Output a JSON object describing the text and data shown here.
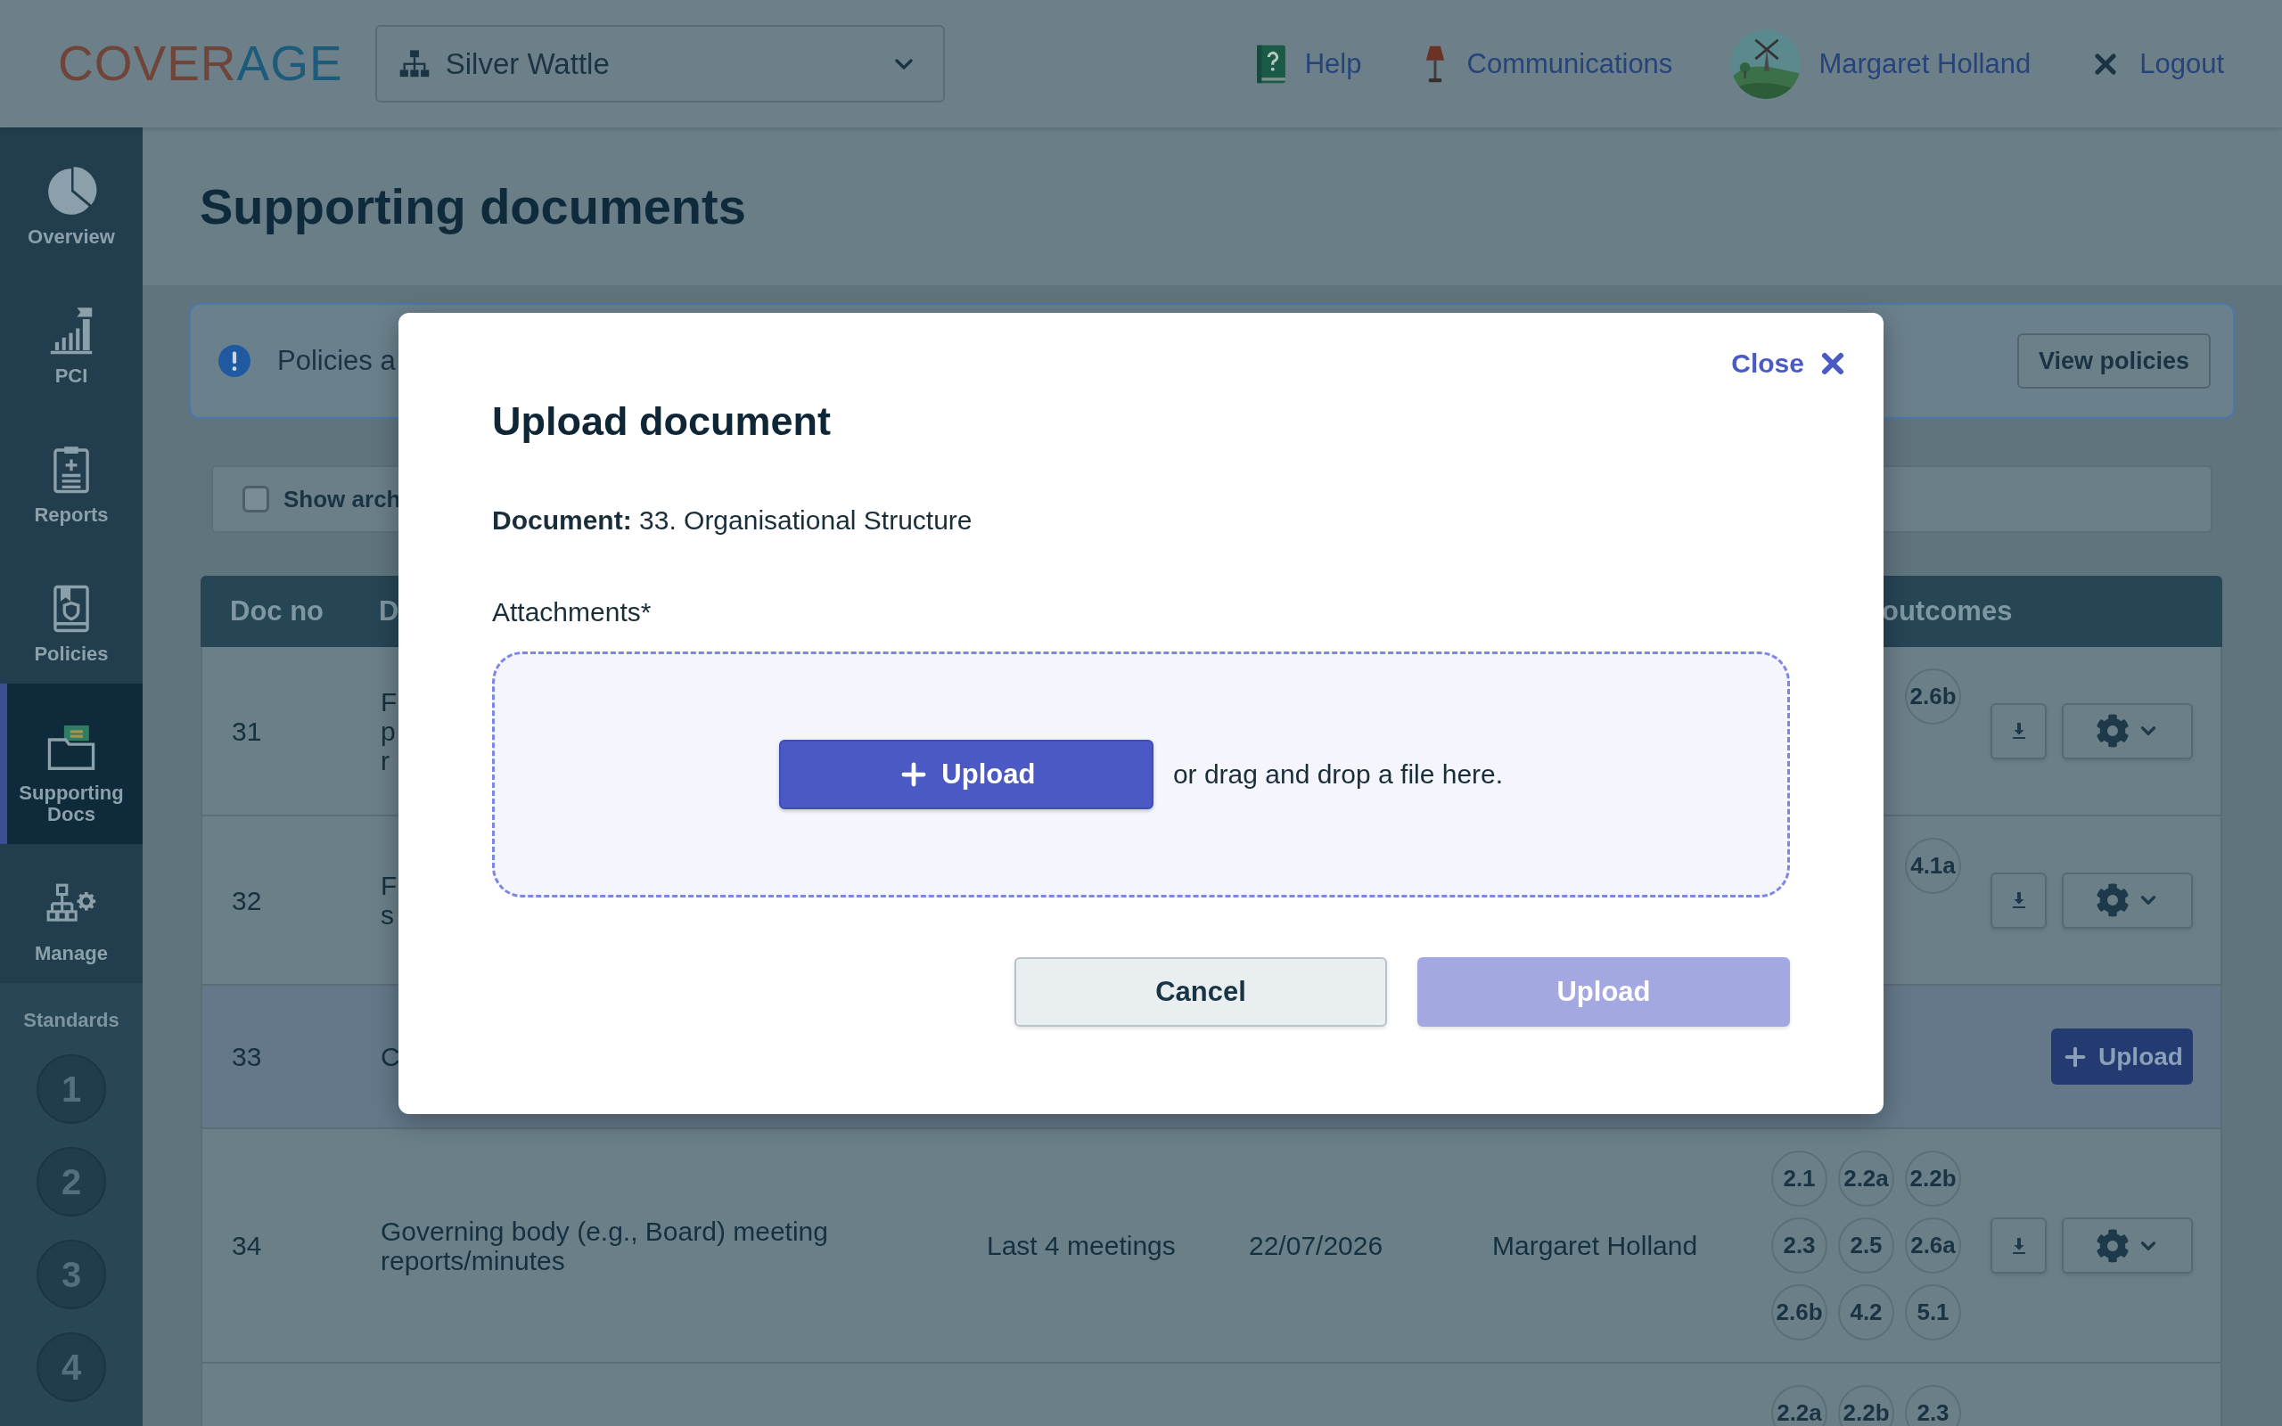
{
  "header": {
    "logo": [
      {
        "text": "COVER",
        "color": "#6e4538"
      },
      {
        "text": "AGE",
        "color": "#1d5b7b"
      }
    ],
    "site_selector": {
      "value": "Silver Wattle"
    },
    "links": [
      {
        "kind": "help",
        "label": "Help"
      },
      {
        "kind": "communications",
        "label": "Communications"
      },
      {
        "kind": "profile",
        "label": "Margaret Holland"
      },
      {
        "kind": "logout",
        "label": "Logout"
      }
    ]
  },
  "sidebar": {
    "items": [
      {
        "kind": "overview",
        "label": "Overview",
        "selected": false
      },
      {
        "kind": "pci",
        "label": "PCI",
        "selected": false
      },
      {
        "kind": "reports",
        "label": "Reports",
        "selected": false
      },
      {
        "kind": "policies",
        "label": "Policies",
        "selected": false
      },
      {
        "kind": "supporting_docs",
        "label": "Supporting Docs",
        "selected": true
      },
      {
        "kind": "manage",
        "label": "Manage",
        "selected": false
      }
    ],
    "standards": {
      "heading": "Standards",
      "items": [
        "1",
        "2",
        "3",
        "4"
      ]
    }
  },
  "page": {
    "title": "Supporting documents"
  },
  "banner": {
    "text": "Policies a",
    "button": "View policies"
  },
  "filter": {
    "label": "Show arch",
    "checked": false
  },
  "table": {
    "columns": [
      "Doc no",
      "D",
      "outcomes"
    ],
    "rows": [
      {
        "kind": "uploaded",
        "doc_no": "31",
        "description": "F\np\nr",
        "outcomes": [
          "2.6b"
        ]
      },
      {
        "kind": "uploaded",
        "doc_no": "32",
        "description": "F\ns",
        "outcomes": [
          "4.1a"
        ]
      },
      {
        "kind": "pending",
        "doc_no": "33",
        "description": "C",
        "upload_label": "Upload"
      },
      {
        "kind": "uploaded",
        "doc_no": "34",
        "description": "Governing body (e.g., Board) meeting\nreports/minutes",
        "frequency": "Last 4 meetings",
        "due_date": "22/07/2026",
        "responsible": "Margaret Holland",
        "outcomes": [
          "2.1",
          "2.2a",
          "2.2b",
          "2.3",
          "2.5",
          "2.6a",
          "2.6b",
          "4.2",
          "5.1"
        ]
      },
      {
        "outcomes": [
          "2.2a",
          "2.2b",
          "2.3"
        ]
      }
    ]
  },
  "modal": {
    "close": "Close",
    "title": "Upload document",
    "document": "**Document:** 33. Organisational Structure",
    "field_label": "Attachments*",
    "dropzone": {
      "button": "Upload",
      "hint": "or drag and drop a file here."
    },
    "buttons": [
      {
        "kind": "secondary",
        "label": "Cancel",
        "disabled": false
      },
      {
        "kind": "primary",
        "label": "Upload",
        "disabled": true
      }
    ]
  }
}
